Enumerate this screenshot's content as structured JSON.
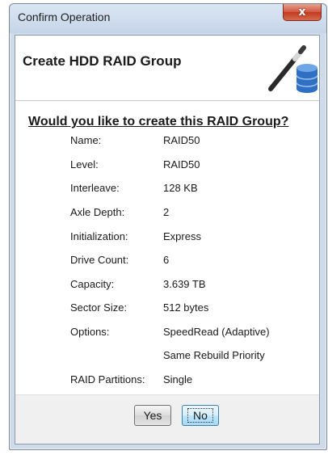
{
  "window": {
    "title": "Confirm Operation",
    "close_label": "x"
  },
  "header": {
    "title": "Create HDD RAID Group",
    "icon": "raid-wand-database-icon"
  },
  "question": "Would you like to create this RAID Group?",
  "details": [
    {
      "label": "Name:",
      "value": "RAID50"
    },
    {
      "label": "Level:",
      "value": "RAID50"
    },
    {
      "label": "Interleave:",
      "value": "128 KB"
    },
    {
      "label": "Axle Depth:",
      "value": "2"
    },
    {
      "label": "Initialization:",
      "value": "Express"
    },
    {
      "label": "Drive Count:",
      "value": "6"
    },
    {
      "label": "Capacity:",
      "value": "3.639 TB"
    },
    {
      "label": "Sector Size:",
      "value": "512 bytes"
    },
    {
      "label": "Options:",
      "value": "SpeedRead (Adaptive)"
    },
    {
      "label": "",
      "value": "Same Rebuild Priority"
    },
    {
      "label": "RAID Partitions:",
      "value": "Single"
    }
  ],
  "buttons": {
    "yes": "Yes",
    "no": "No"
  },
  "colors": {
    "close_button": "#c9452a",
    "default_button_border": "#3c7fb1",
    "database_icon": "#2f6fc4"
  }
}
